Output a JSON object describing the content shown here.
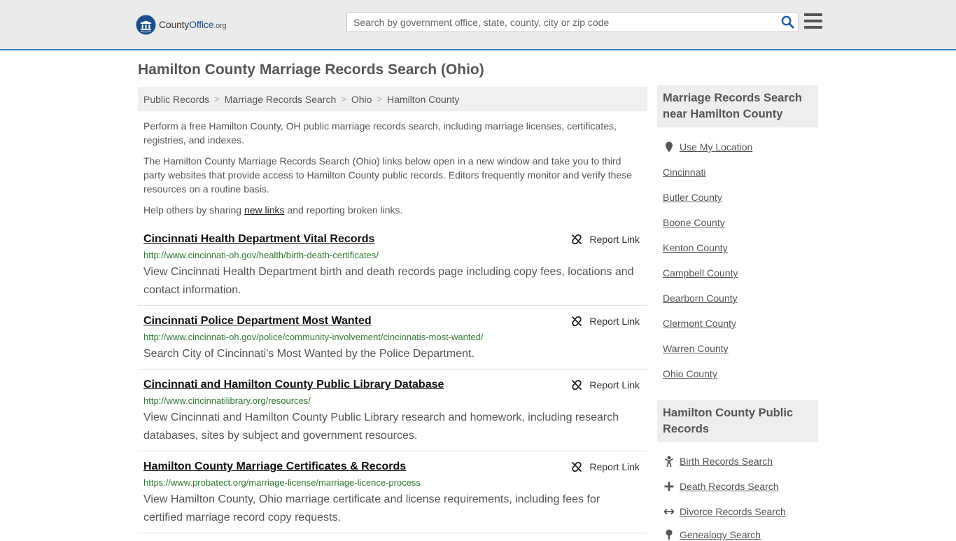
{
  "header": {
    "logo_prefix": "County",
    "logo_brand": "Office",
    "logo_tld": ".org",
    "search_placeholder": "Search by government office, state, county, city or zip code",
    "search_icon": "search-icon",
    "menu_icon": "hamburger-menu-icon",
    "accent_color": "#3f7bbf"
  },
  "page": {
    "title": "Hamilton County Marriage Records Search (Ohio)"
  },
  "breadcrumb": [
    "Public Records",
    "Marriage Records Search",
    "Ohio",
    "Hamilton County"
  ],
  "intro": {
    "p1": "Perform a free Hamilton County, OH public marriage records search, including marriage licenses, certificates, registries, and indexes.",
    "p2": "The Hamilton County Marriage Records Search (Ohio) links below open in a new window and take you to third party websites that provide access to Hamilton County public records. Editors frequently monitor and verify these resources on a routine basis.",
    "p3_before": "Help others by sharing ",
    "p3_link": "new links",
    "p3_after": " and reporting broken links."
  },
  "report_label": "Report Link",
  "results": [
    {
      "title": "Cincinnati Health Department Vital Records",
      "url": "http://www.cincinnati-oh.gov/health/birth-death-certificates/",
      "description": "View Cincinnati Health Department birth and death records page including copy fees, locations and contact information."
    },
    {
      "title": "Cincinnati Police Department Most Wanted",
      "url": "http://www.cincinnati-oh.gov/police/community-involvement/cincinnatis-most-wanted/",
      "description": "Search City of Cincinnati's Most Wanted by the Police Department."
    },
    {
      "title": "Cincinnati and Hamilton County Public Library Database",
      "url": "http://www.cincinnatilibrary.org/resources/",
      "description": "View Cincinnati and Hamilton County Public Library research and homework, including research databases, sites by subject and government resources."
    },
    {
      "title": "Hamilton County Marriage Certificates & Records",
      "url": "https://www.probatect.org/marriage-license/marriage-licence-process",
      "description": "View Hamilton County, Ohio marriage certificate and license requirements, including fees for certified marriage record copy requests."
    }
  ],
  "sidebar": {
    "nearby_heading": "Marriage Records Search near Hamilton County",
    "use_location": "Use My Location",
    "nearby": [
      "Cincinnati",
      "Butler County",
      "Boone County",
      "Kenton County",
      "Campbell County",
      "Dearborn County",
      "Clermont County",
      "Warren County",
      "Ohio County"
    ],
    "public_heading": "Hamilton County Public Records",
    "public_records": [
      {
        "label": "Birth Records Search",
        "icon": "baby-icon"
      },
      {
        "label": "Death Records Search",
        "icon": "cross-icon"
      },
      {
        "label": "Divorce Records Search",
        "icon": "arrows-split-icon"
      },
      {
        "label": "Genealogy Search",
        "icon": "tree-icon"
      }
    ]
  }
}
